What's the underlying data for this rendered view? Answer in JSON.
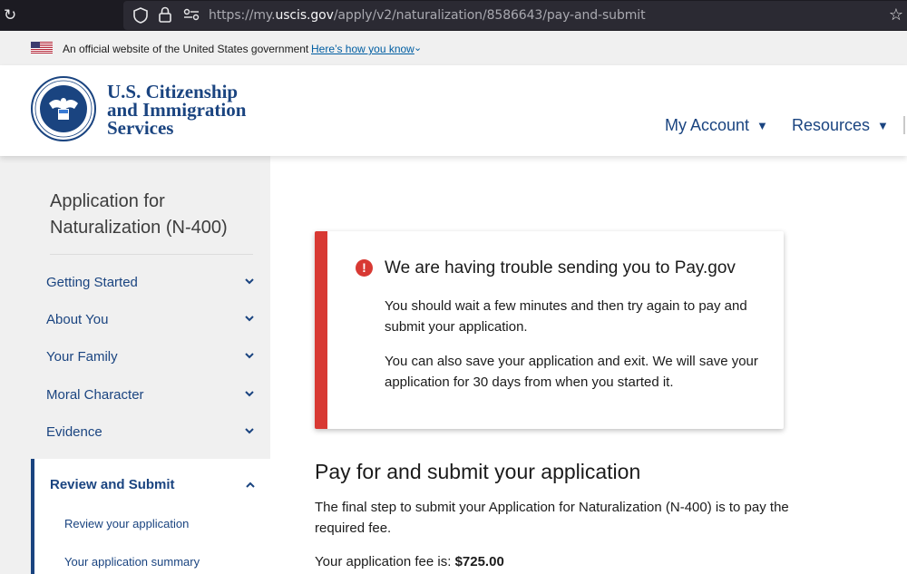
{
  "browser": {
    "url_prefix": "https://my.",
    "url_domain": "uscis.gov",
    "url_path": "/apply/v2/naturalization/8586643/pay-and-submit"
  },
  "gov_banner": {
    "official_text": "An official website of the United States government",
    "how_link": "Here’s how you know"
  },
  "header": {
    "agency_line1": "U.S. Citizenship",
    "agency_line2": "and Immigration",
    "agency_line3": "Services",
    "seal_ring_text": "U.S. DEPARTMENT OF HOMELAND SECURITY",
    "nav": [
      {
        "label": "My Account"
      },
      {
        "label": "Resources"
      }
    ]
  },
  "sidebar": {
    "title_line1": "Application for",
    "title_line2": "Naturalization (N-400)",
    "items": [
      {
        "label": "Getting Started"
      },
      {
        "label": "About You"
      },
      {
        "label": "Your Family"
      },
      {
        "label": "Moral Character"
      },
      {
        "label": "Evidence"
      }
    ],
    "active": {
      "label": "Review and Submit",
      "subitems": [
        {
          "label": "Review your application"
        },
        {
          "label": "Your application summary"
        }
      ]
    }
  },
  "alert": {
    "title": "We are having trouble sending you to Pay.gov",
    "p1": "You should wait a few minutes and then try again to pay and submit your application.",
    "p2": "You can also save your application and exit. We will save your application for 30 days from when you started it."
  },
  "main": {
    "heading": "Pay for and submit your application",
    "body": "The final step to submit your Application for Naturalization (N-400) is to pay the required fee.",
    "fee_label": "Your application fee is:",
    "fee_amount": "$725.00"
  },
  "colors": {
    "brand_navy": "#1a4480",
    "alert_red": "#d83933",
    "link_blue": "#005ea2",
    "sidebar_bg": "#f0f0f0"
  }
}
